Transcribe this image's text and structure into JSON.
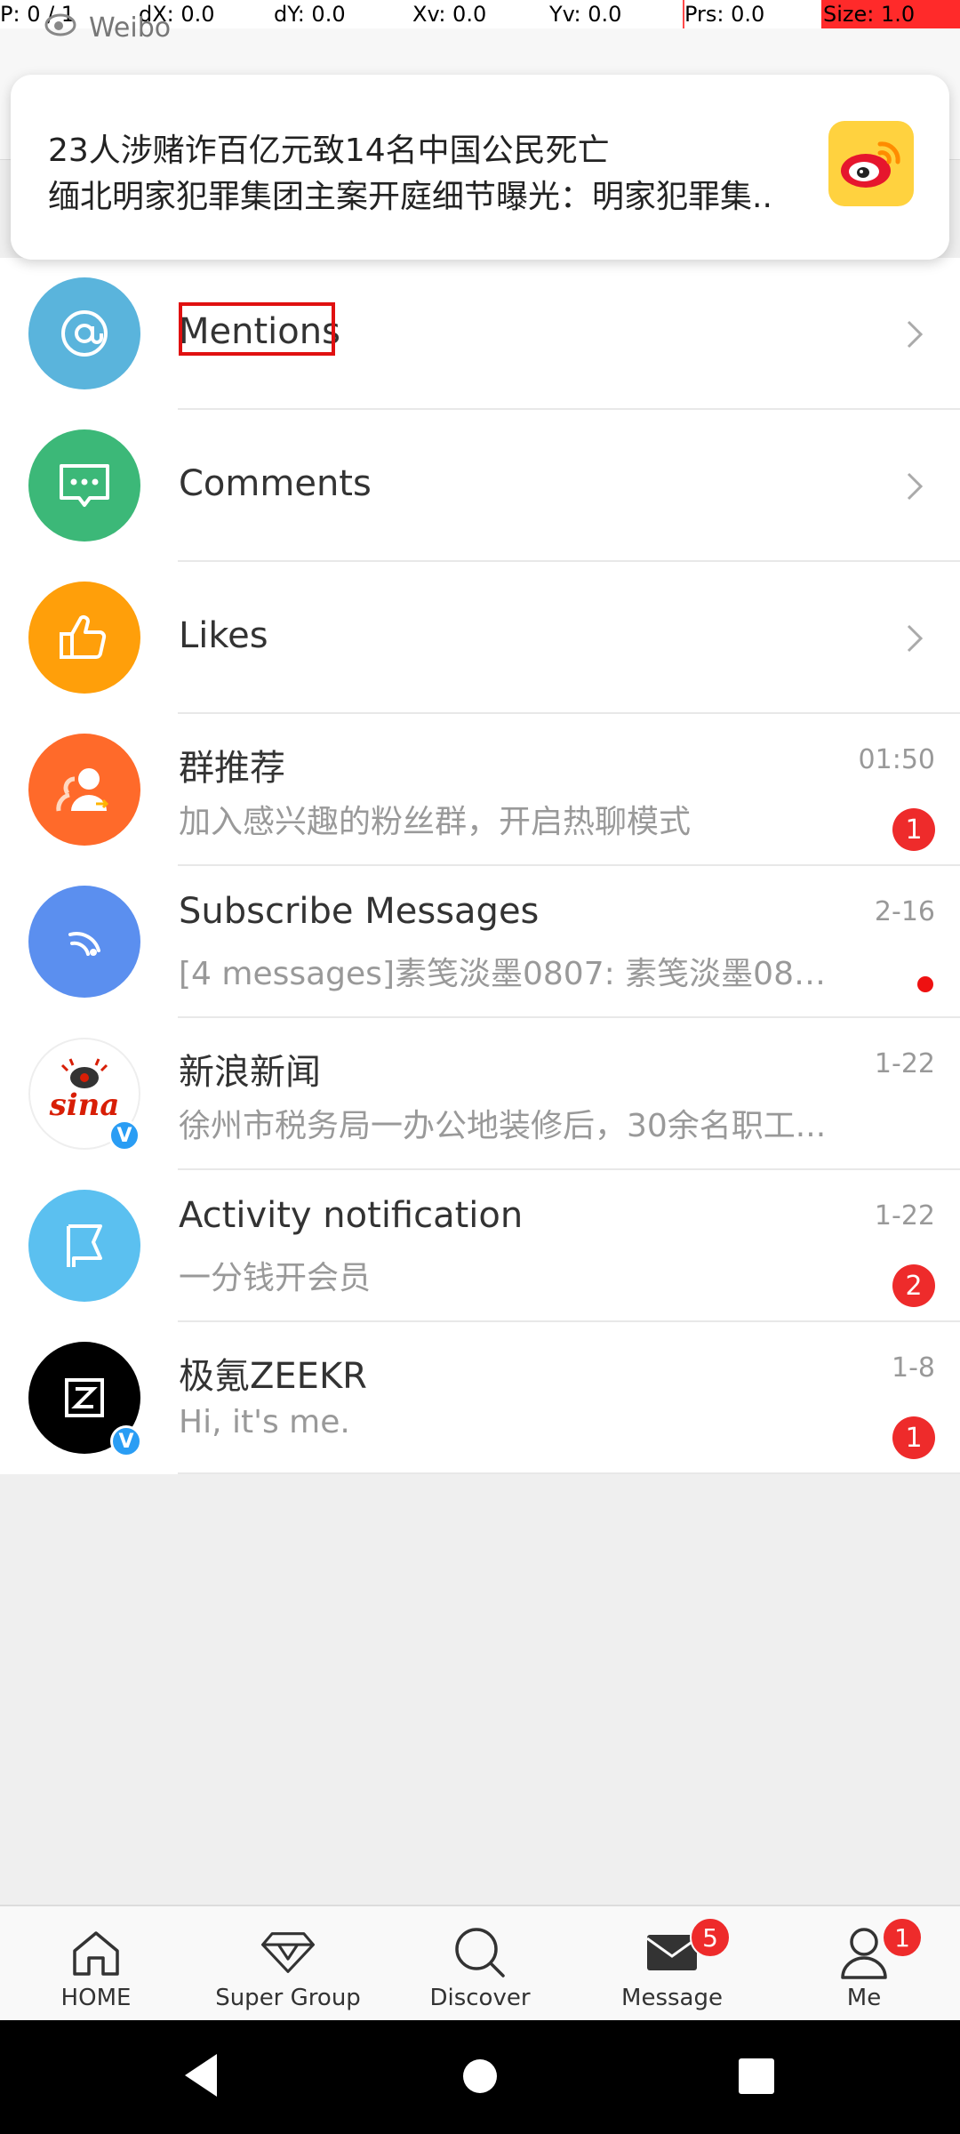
{
  "overlay": {
    "p": "P: 0 / 1",
    "dx": "dX: 0.0",
    "dy": "dY: 0.0",
    "xv": "Xv: 0.0",
    "yv": "Yv: 0.0",
    "prs": "Prs: 0.0",
    "size": "Size: 1.0"
  },
  "app_label": "Weibo",
  "notification": {
    "title": "23人涉赌诈百亿元致14名中国公民死亡",
    "body": "缅北明家犯罪集团主案开庭细节曝光：明家犯罪集..",
    "icon": "weibo-logo-icon"
  },
  "list": [
    {
      "title": "Mentions",
      "icon": "at-icon",
      "color": "#5ab4dc"
    },
    {
      "title": "Comments",
      "icon": "comment-icon",
      "color": "#3cb878"
    },
    {
      "title": "Likes",
      "icon": "thumbs-up-icon",
      "color": "#ff9f0a"
    },
    {
      "title": "群推荐",
      "subtitle": "加入感兴趣的粉丝群，开启热聊模式",
      "time": "01:50",
      "badge": "1",
      "icon": "group-icon",
      "color": "#ff6a2a"
    },
    {
      "title": "Subscribe Messages",
      "subtitle": "[4 messages]素笺淡墨0807: 素笺淡墨0807 ...",
      "time": "2-16",
      "icon": "rss-icon",
      "color": "#5b8fef"
    },
    {
      "title": "新浪新闻",
      "subtitle": "徐州市税务局一办公地装修后，30余名职工...",
      "time": "1-22",
      "icon": "sina-logo-icon",
      "verified": "V"
    },
    {
      "title": "Activity notification",
      "subtitle": "一分钱开会员",
      "time": "1-22",
      "badge": "2",
      "icon": "flag-icon",
      "color": "#5bc0f0"
    },
    {
      "title": "极氪ZEEKR",
      "subtitle": "Hi, it's me.",
      "time": "1-8",
      "badge": "1",
      "icon": "zeekr-logo-icon",
      "verified": "V"
    }
  ],
  "tabs": [
    {
      "label": "HOME",
      "icon": "home-icon"
    },
    {
      "label": "Super Group",
      "icon": "diamond-icon"
    },
    {
      "label": "Discover",
      "icon": "search-icon"
    },
    {
      "label": "Message",
      "icon": "envelope-icon",
      "badge": "5"
    },
    {
      "label": "Me",
      "icon": "person-icon",
      "badge": "1"
    }
  ],
  "colors": {
    "accent_red": "#ee2b2b",
    "badge_red": "#ee2b2b"
  }
}
